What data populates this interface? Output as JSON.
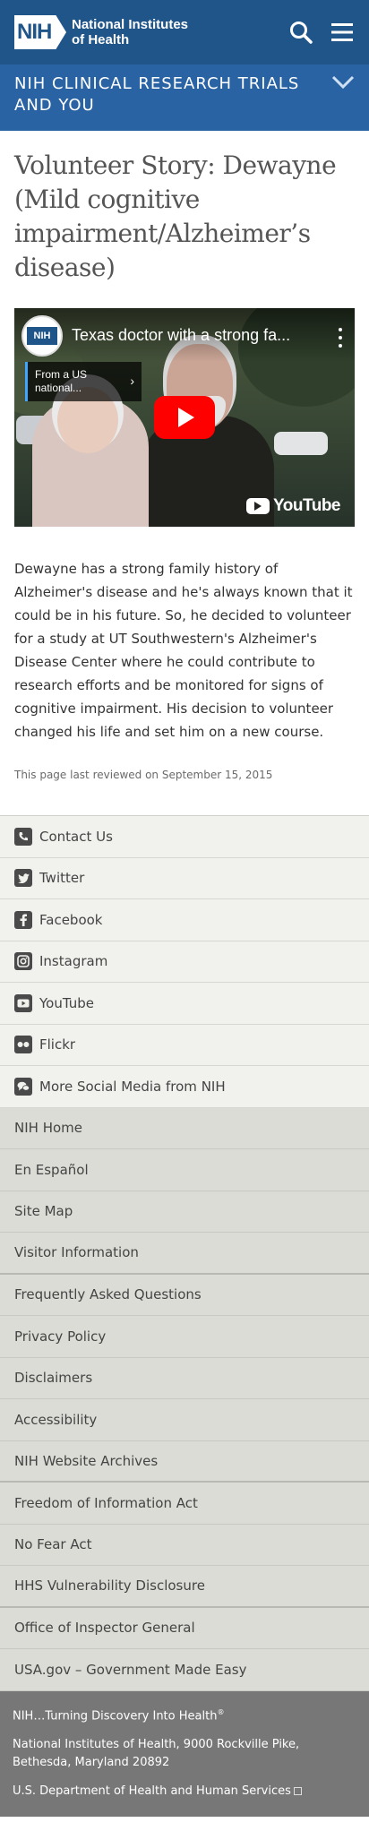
{
  "header": {
    "logo_abbr": "NIH",
    "logo_line1": "National Institutes",
    "logo_line2": "of Health",
    "search_icon": "search-icon",
    "menu_icon": "hamburger-menu-icon",
    "color": "#20558a"
  },
  "section_banner": {
    "title": "NIH CLINICAL RESEARCH TRIALS AND YOU",
    "chevron_icon": "chevron-down-icon",
    "color": "#2a63a3"
  },
  "page": {
    "title": "Volunteer Story: Dewayne (Mild cognitive impairment/Alzheimer’s disease)"
  },
  "video": {
    "title": "Texas doctor with a strong fa...",
    "info_panel": "From a US national...",
    "channel_logo": "NIH",
    "play_icon": "play-icon",
    "brand": "YouTube"
  },
  "story": {
    "text": "Dewayne has a strong family history of Alzheimer's disease and he's always known that it could be in his future. So, he decided to volunteer for a study at UT Southwestern's Alzheimer's Disease Center where he could contribute to research efforts and be monitored for signs of cognitive impairment. His decision to volunteer changed his life and set him on a new course.",
    "reviewed": "This page last reviewed on September 15, 2015"
  },
  "social": [
    {
      "label": "Contact Us",
      "icon": "phone-icon"
    },
    {
      "label": "Twitter",
      "icon": "twitter-icon"
    },
    {
      "label": "Facebook",
      "icon": "facebook-icon"
    },
    {
      "label": "Instagram",
      "icon": "instagram-icon"
    },
    {
      "label": "YouTube",
      "icon": "youtube-icon"
    },
    {
      "label": "Flickr",
      "icon": "flickr-icon"
    },
    {
      "label": "More Social Media from NIH",
      "icon": "chat-bubbles-icon"
    }
  ],
  "links": [
    "NIH Home",
    "En Español",
    "Site Map",
    "Visitor Information",
    "Frequently Asked Questions",
    "Privacy Policy",
    "Disclaimers",
    "Accessibility",
    "NIH Website Archives",
    "Freedom of Information Act",
    "No Fear Act",
    "HHS Vulnerability Disclosure",
    "Office of Inspector General",
    "USA.gov – Government Made Easy"
  ],
  "footer": {
    "tagline": "NIH…Turning Discovery Into Health",
    "tagline_mark": "®",
    "address": "National Institutes of Health, 9000 Rockville Pike, Bethesda, Maryland 20892",
    "hhs": "U.S. Department of Health and Human Services",
    "external_icon": "external-link-icon"
  }
}
